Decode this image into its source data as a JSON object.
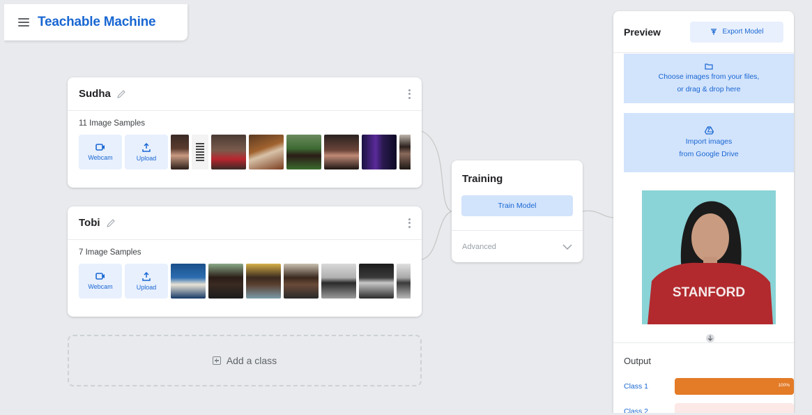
{
  "app": {
    "title": "Teachable Machine"
  },
  "classes": [
    {
      "name": "Sudha",
      "samples_label": "11 Image Samples",
      "webcam_label": "Webcam",
      "upload_label": "Upload"
    },
    {
      "name": "Tobi",
      "samples_label": "7 Image Samples",
      "webcam_label": "Webcam",
      "upload_label": "Upload"
    }
  ],
  "add_class": {
    "label": "Add a class"
  },
  "training": {
    "title": "Training",
    "train_button": "Train Model",
    "advanced_label": "Advanced"
  },
  "preview": {
    "title": "Preview",
    "export_button": "Export Model",
    "file_drop": {
      "line1": "Choose images from your files,",
      "line2": "or drag & drop here"
    },
    "drive_import": {
      "line1": "Import images",
      "line2": "from Google Drive"
    },
    "webcam_shirt_text": "STANFORD",
    "output": {
      "title": "Output",
      "rows": [
        {
          "label": "Class 1",
          "percent_text": "100%",
          "fraction": 1.0,
          "color": "#e37b27"
        },
        {
          "label": "Class 2",
          "percent_text": "",
          "fraction": 0.0,
          "color": "#fce8e6"
        }
      ]
    }
  },
  "colors": {
    "accent": "#1967d2",
    "light_blue": "#d2e3fc",
    "orange": "#e37b27"
  }
}
